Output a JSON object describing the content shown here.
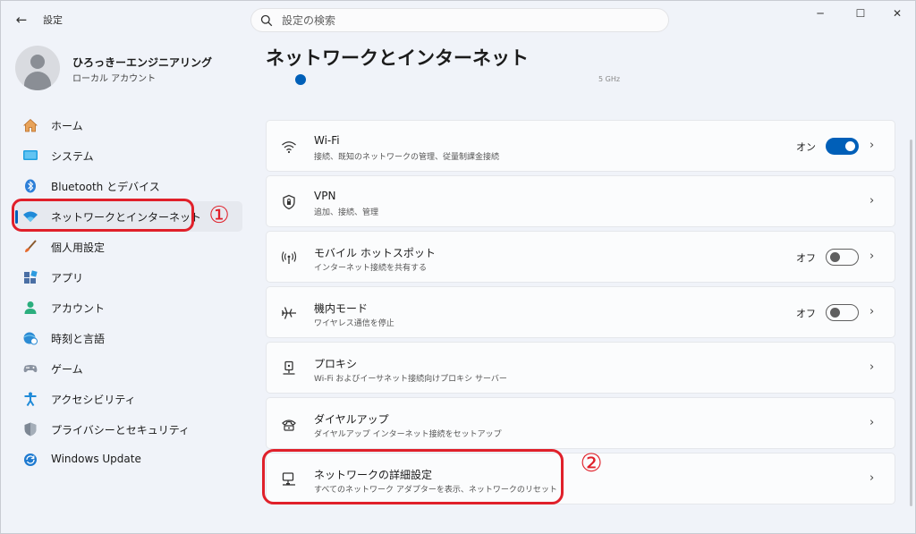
{
  "titlebar": {
    "back_glyph": "←",
    "app_title": "設定",
    "search_placeholder": "設定の検索",
    "minimize_glyph": "─",
    "maximize_glyph": "☐",
    "close_glyph": "✕"
  },
  "profile": {
    "name": "ひろっきーエンジニアリング",
    "account_type": "ローカル アカウント"
  },
  "sidebar": {
    "items": [
      {
        "label": "ホーム",
        "icon": "home-icon"
      },
      {
        "label": "システム",
        "icon": "system-icon"
      },
      {
        "label": "Bluetooth とデバイス",
        "icon": "bluetooth-icon"
      },
      {
        "label": "ネットワークとインターネット",
        "icon": "wifi-icon",
        "selected": true
      },
      {
        "label": "個人用設定",
        "icon": "brush-icon"
      },
      {
        "label": "アプリ",
        "icon": "apps-icon"
      },
      {
        "label": "アカウント",
        "icon": "account-icon"
      },
      {
        "label": "時刻と言語",
        "icon": "globe-clock-icon"
      },
      {
        "label": "ゲーム",
        "icon": "gamepad-icon"
      },
      {
        "label": "アクセシビリティ",
        "icon": "accessibility-icon"
      },
      {
        "label": "プライバシーとセキュリティ",
        "icon": "shield-icon"
      },
      {
        "label": "Windows Update",
        "icon": "update-icon"
      }
    ]
  },
  "annotations": {
    "one": "①",
    "two": "②"
  },
  "main": {
    "title": "ネットワークとインターネット",
    "peek_text": "5 GHz",
    "cards": [
      {
        "title": "Wi-Fi",
        "desc": "接続、既知のネットワークの管理、従量制課金接続",
        "icon": "wifi-icon",
        "state": "オン",
        "toggle": true
      },
      {
        "title": "VPN",
        "desc": "追加、接続、管理",
        "icon": "vpn-shield-icon"
      },
      {
        "title": "モバイル ホットスポット",
        "desc": "インターネット接続を共有する",
        "icon": "hotspot-icon",
        "state": "オフ",
        "toggle": false
      },
      {
        "title": "機内モード",
        "desc": "ワイヤレス通信を停止",
        "icon": "airplane-icon",
        "state": "オフ",
        "toggle": false
      },
      {
        "title": "プロキシ",
        "desc": "Wi-Fi およびイーサネット接続向けプロキシ サーバー",
        "icon": "proxy-icon"
      },
      {
        "title": "ダイヤルアップ",
        "desc": "ダイヤルアップ インターネット接続をセットアップ",
        "icon": "dialup-icon"
      },
      {
        "title": "ネットワークの詳細設定",
        "desc": "すべてのネットワーク アダプターを表示、ネットワークのリセット",
        "icon": "network-pc-icon"
      }
    ]
  },
  "colors": {
    "accent": "#005fb8",
    "annotation_red": "#e0202a"
  }
}
